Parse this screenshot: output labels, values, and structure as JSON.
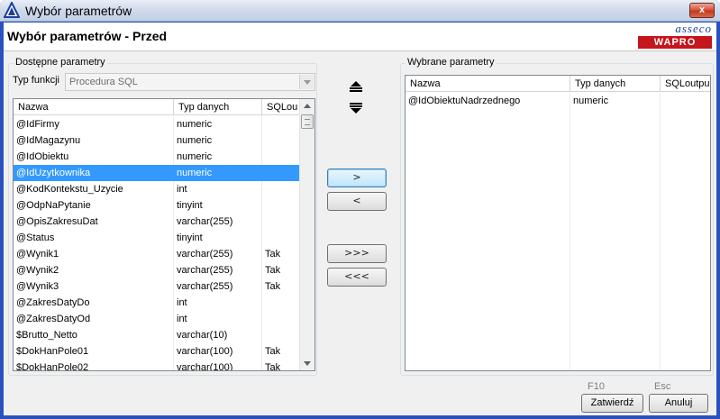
{
  "window": {
    "title": "Wybór parametrów",
    "close_label": "x"
  },
  "header": {
    "title": "Wybór parametrów - Przed",
    "logo_top": "asseco",
    "logo_bottom": "WAPRO"
  },
  "available": {
    "group_label": "Dostępne parametry",
    "function_type_label": "Typ funkcji",
    "function_type_value": "Procedura SQL",
    "columns": [
      "Nazwa",
      "Typ danych",
      "SQLou"
    ],
    "rows": [
      {
        "name": "@IdFirmy",
        "type": "numeric",
        "sql": ""
      },
      {
        "name": "@IdMagazynu",
        "type": "numeric",
        "sql": ""
      },
      {
        "name": "@IdObiektu",
        "type": "numeric",
        "sql": ""
      },
      {
        "name": "@IdUzytkownika",
        "type": "numeric",
        "sql": "",
        "selected": true
      },
      {
        "name": "@KodKontekstu_Uzycie",
        "type": "int",
        "sql": ""
      },
      {
        "name": "@OdpNaPytanie",
        "type": "tinyint",
        "sql": ""
      },
      {
        "name": "@OpisZakresuDat",
        "type": "varchar(255)",
        "sql": ""
      },
      {
        "name": "@Status",
        "type": "tinyint",
        "sql": ""
      },
      {
        "name": "@Wynik1",
        "type": "varchar(255)",
        "sql": "Tak"
      },
      {
        "name": "@Wynik2",
        "type": "varchar(255)",
        "sql": "Tak"
      },
      {
        "name": "@Wynik3",
        "type": "varchar(255)",
        "sql": "Tak"
      },
      {
        "name": "@ZakresDatyDo",
        "type": "int",
        "sql": ""
      },
      {
        "name": "@ZakresDatyOd",
        "type": "int",
        "sql": ""
      },
      {
        "name": "$Brutto_Netto",
        "type": "varchar(10)",
        "sql": ""
      },
      {
        "name": "$DokHanPole01",
        "type": "varchar(100)",
        "sql": "Tak"
      },
      {
        "name": "$DokHanPole02",
        "type": "varchar(100)",
        "sql": "Tak"
      }
    ]
  },
  "selected": {
    "group_label": "Wybrane parametry",
    "columns": [
      "Nazwa",
      "Typ danych",
      "SQLoutpu"
    ],
    "rows": [
      {
        "name": "@IdObiektuNadrzednego",
        "type": "numeric",
        "sql": ""
      }
    ]
  },
  "transfer": {
    "add_one": ">",
    "remove_one": "<",
    "add_all": ">>>",
    "remove_all": "<<<"
  },
  "footer": {
    "confirm_key": "F10",
    "confirm_label": "Zatwierdź",
    "cancel_key": "Esc",
    "cancel_label": "Anuluj"
  },
  "colors": {
    "selection": "#3399ff",
    "title_accent": "#2a52be",
    "logo_red": "#c4161c",
    "logo_blue": "#1d3f9c"
  }
}
